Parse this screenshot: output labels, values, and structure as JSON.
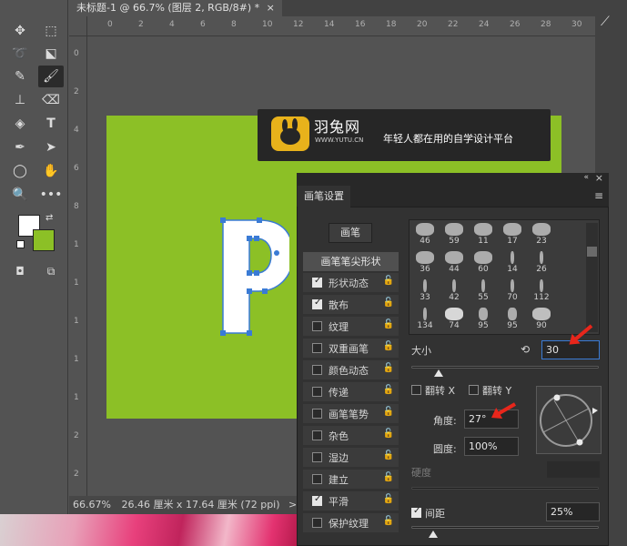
{
  "document": {
    "tab_title": "未标题-1 @ 66.7% (图层 2, RGB/8#) *",
    "close": "×"
  },
  "ruler": {
    "h_labels": [
      "0",
      "2",
      "4",
      "6",
      "8",
      "10",
      "12",
      "14",
      "16",
      "18",
      "20",
      "22",
      "24",
      "26",
      "28",
      "30"
    ],
    "v_labels": [
      "0",
      "2",
      "4",
      "6",
      "8",
      "1",
      "1",
      "1",
      "1",
      "1",
      "2",
      "2"
    ]
  },
  "status": {
    "zoom": "66.67%",
    "size": "26.46 厘米 x 17.64 厘米 (72 ppi)",
    "arrow": ">"
  },
  "banner": {
    "logo_name": "羽兔网",
    "logo_url": "WWW.YUTU.CN",
    "slogan": "年轻人都在用的自学设计平台"
  },
  "canvas": {
    "letter": "P",
    "background_color": "#8cc026"
  },
  "panel": {
    "title": "画笔设置",
    "brush_button": "画笔",
    "tip_shape": "画笔笔尖形状",
    "options": [
      {
        "label": "形状动态",
        "checked": true
      },
      {
        "label": "散布",
        "checked": true
      },
      {
        "label": "纹理",
        "checked": false
      },
      {
        "label": "双重画笔",
        "checked": false
      },
      {
        "label": "颜色动态",
        "checked": false
      },
      {
        "label": "传递",
        "checked": false
      },
      {
        "label": "画笔笔势",
        "checked": false
      },
      {
        "label": "杂色",
        "checked": false
      },
      {
        "label": "湿边",
        "checked": false
      },
      {
        "label": "建立",
        "checked": false
      },
      {
        "label": "平滑",
        "checked": true
      },
      {
        "label": "保护纹理",
        "checked": false
      }
    ],
    "brushes": [
      "46",
      "59",
      "11",
      "17",
      "23",
      "36",
      "44",
      "60",
      "14",
      "26",
      "33",
      "42",
      "55",
      "70",
      "112",
      "134",
      "74",
      "95",
      "95",
      "90"
    ],
    "size_label": "大小",
    "size_value": "30",
    "flip_x": "翻转 X",
    "flip_y": "翻转 Y",
    "angle_label": "角度:",
    "angle_value": "27°",
    "roundness_label": "圆度:",
    "roundness_value": "100%",
    "hardness_label": "硬度",
    "spacing_label": "间距",
    "spacing_value": "25%",
    "spacing_checked": true
  }
}
